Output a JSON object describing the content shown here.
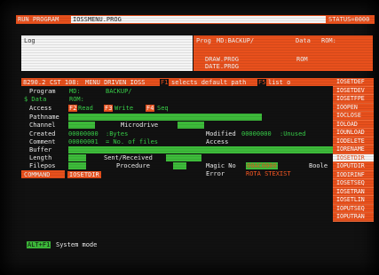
{
  "topbar": {
    "run_label": "RUN PROGRAM",
    "program_field": "IOSSMENU.PROG",
    "status_label": "STATUS=0000"
  },
  "log": {
    "title": "Log"
  },
  "right_panel": {
    "prog_label": "Prog",
    "prog_value": "MD:BACKUP/",
    "data_label": "Data",
    "data_value": "ROM:",
    "files": [
      "DRAW.PROG",
      "DATE.PROG"
    ],
    "rom_value": "ROM"
  },
  "menu_line": {
    "address": "8290.2",
    "cst": "CST 108:",
    "title": "MENU DRIVEN IOSS",
    "f1_key": "F1",
    "f1_text": "selects default path",
    "f5_key": "F5",
    "f5_text": "list o"
  },
  "form": {
    "program_label": "Program",
    "program_dev": "MD:",
    "program_value": "BACKUP/",
    "data_label": "$ Data",
    "data_dev": "ROM:",
    "access_label": "Access",
    "access_keys": [
      {
        "key": "F2",
        "text": "Read"
      },
      {
        "key": "F3",
        "text": "Write"
      },
      {
        "key": "F4",
        "text": "Seq"
      }
    ],
    "pathname_label": "Pathname",
    "channel_label": "Channel",
    "channel_value": "Microdrive",
    "created_label": "Created",
    "created_value": "00000000",
    "created_unit": ":Bytes",
    "modified_label": "Modified",
    "modified_value": "00000000",
    "modified_unit": ":Unused",
    "comment_label": "Comment",
    "comment_value": "00000001",
    "comment_unit": "= No. of files",
    "access2_label": "Access",
    "buffer_label": "Buffer",
    "length_label": "Length",
    "length_value": "Sent/Received",
    "filepos_label": "Filepos",
    "filepos_value": "Procedure",
    "magic_label": "Magic No",
    "magic_value": "00AC0000",
    "boole_label": "Boole",
    "error_label": "Error",
    "error_value": "ROTA STEXIST",
    "command_label": "COMMAND",
    "command_value": "IOSETDIR"
  },
  "commands": [
    "IOSETDEF",
    "IOSETDEV",
    "IOSETFPE",
    "IOOPEN",
    "IOCLOSE",
    "IOLOAD",
    "IOUNLOAD",
    "IODELETE",
    "IORENAME",
    "IOSETDIR",
    "IOPUTDIR",
    "IODIRINF",
    "IOSETSEQ",
    "IOSETRAN",
    "IOSETLIN",
    "IOPUTSEQ",
    "IOPUTRAN"
  ],
  "selected_command": "IOSETDIR",
  "bottom": {
    "key_label": "ALT+F1",
    "mode_text": "System mode"
  }
}
